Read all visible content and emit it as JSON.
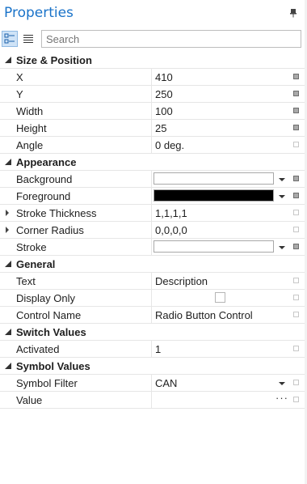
{
  "panel": {
    "title": "Properties"
  },
  "toolbar": {
    "search_placeholder": "Search"
  },
  "colors": {
    "title": "#1a73c9",
    "background_swatch": "#ffffff",
    "foreground_swatch": "#000000",
    "stroke_swatch": "#ffffff"
  },
  "categories": {
    "size_position": {
      "name": "Size & Position",
      "x": {
        "name": "X",
        "value": "410"
      },
      "y": {
        "name": "Y",
        "value": "250"
      },
      "width": {
        "name": "Width",
        "value": "100"
      },
      "height": {
        "name": "Height",
        "value": "25"
      },
      "angle": {
        "name": "Angle",
        "value": "0 deg."
      }
    },
    "appearance": {
      "name": "Appearance",
      "background": {
        "name": "Background"
      },
      "foreground": {
        "name": "Foreground"
      },
      "stroke_thickness": {
        "name": "Stroke Thickness",
        "value": "1,1,1,1"
      },
      "corner_radius": {
        "name": "Corner Radius",
        "value": "0,0,0,0"
      },
      "stroke": {
        "name": "Stroke"
      }
    },
    "general": {
      "name": "General",
      "text": {
        "name": "Text",
        "value": "Description"
      },
      "display_only": {
        "name": "Display Only",
        "checked": false
      },
      "control_name": {
        "name": "Control Name",
        "value": "Radio Button Control"
      }
    },
    "switch_values": {
      "name": "Switch Values",
      "activated": {
        "name": "Activated",
        "value": "1"
      }
    },
    "symbol_values": {
      "name": "Symbol Values",
      "symbol_filter": {
        "name": "Symbol Filter",
        "value": "CAN"
      },
      "value": {
        "name": "Value",
        "value": ""
      }
    }
  }
}
